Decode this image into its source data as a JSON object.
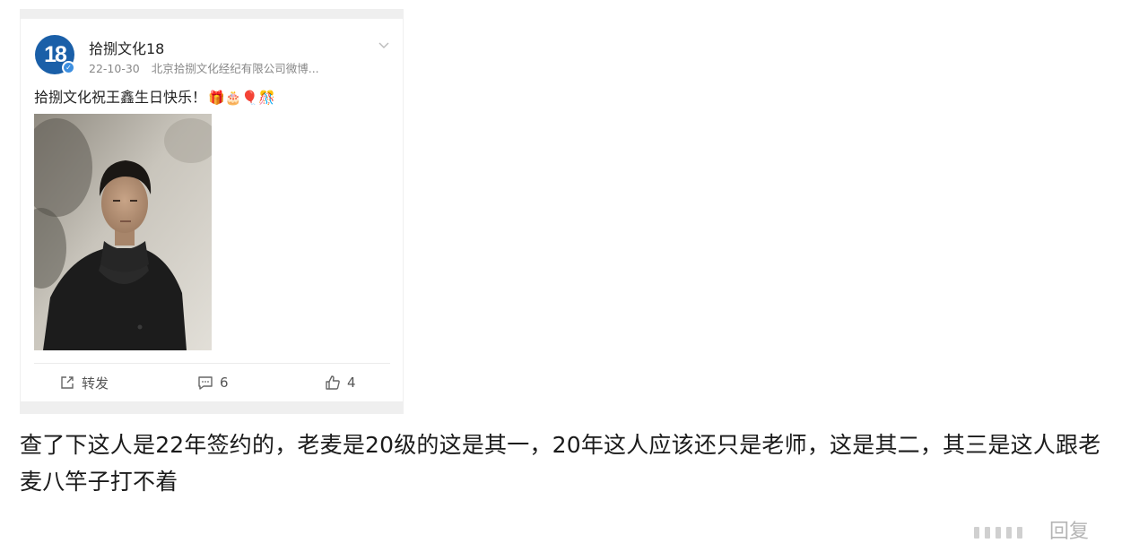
{
  "post": {
    "avatar_text": "18",
    "user_name": "拾捌文化18",
    "date": "22-10-30",
    "source": "北京拾捌文化经纪有限公司微博...",
    "text": "拾捌文化祝王鑫生日快乐！",
    "emojis": "🎁🎂🎈🎊",
    "actions": {
      "repost_label": "转发",
      "comment_count": "6",
      "like_count": "4"
    }
  },
  "commentary": {
    "text": "查了下这人是22年签约的，老麦是20级的这是其一，20年这人应该还只是老师，这是其二，其三是这人跟老麦八竿子打不着"
  },
  "footer": {
    "reply_label": "回复"
  },
  "colors": {
    "avatar_bg": "#1a5fa8",
    "verified_badge": "#3d8fe0",
    "text_primary": "#222222",
    "text_meta": "#888888"
  },
  "icons": {
    "menu": "chevron-down-icon",
    "repost": "share-icon",
    "comment": "comment-icon",
    "like": "thumbs-up-icon",
    "verified": "verified-badge-icon"
  }
}
